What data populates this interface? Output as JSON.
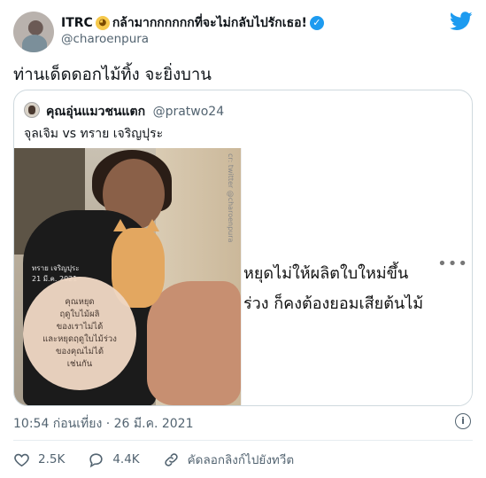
{
  "tweet": {
    "display_name": "ITRC 😼กล้ามากกกกกกที่จะไม่กลับไปรักเธอ!",
    "name_text": "ITRC",
    "name_suffix": "กล้ามากกกกกกที่จะไม่กลับไปรักเธอ!",
    "handle": "@charoenpura",
    "text": "ท่านเด็ดดอกไม้ทิ้ง จะยิ่งบาน",
    "timestamp": "10:54 ก่อนเที่ยง · 26 มี.ค. 2021"
  },
  "quoted": {
    "display_name": "คุณอุ่นแมวชนแตก",
    "handle": "@pratwo24",
    "text": "จุลเจิม vs ทราย เจริญปุระ",
    "photo_credit": "ทราย เจริญปุระ",
    "photo_date": "21 มี.ค. 2021",
    "circle_lines": [
      "คุณหยุด",
      "ฤดูใบไม้ผลิ",
      "ของเราไม่ได้",
      "และหยุดฤดูใบไม้ร่วง",
      "ของคุณไม่ได้",
      "เช่นกัน"
    ],
    "side_credit": "cr: twitter @charoenpura",
    "overlay_line1": "หยุดไม่ให้ผลิตใบใหม่ขึ้น",
    "overlay_line2": "ร่วง ก็คงต้องยอมเสียต้นไม้",
    "more": "•••"
  },
  "actions": {
    "likes": "2.5K",
    "replies": "4.4K",
    "copy_link": "คัดลอกลิงก์ไปยังทวีต"
  },
  "colors": {
    "twitter_blue": "#1d9bf0",
    "secondary_text": "#536471",
    "border": "#cfd9de"
  }
}
